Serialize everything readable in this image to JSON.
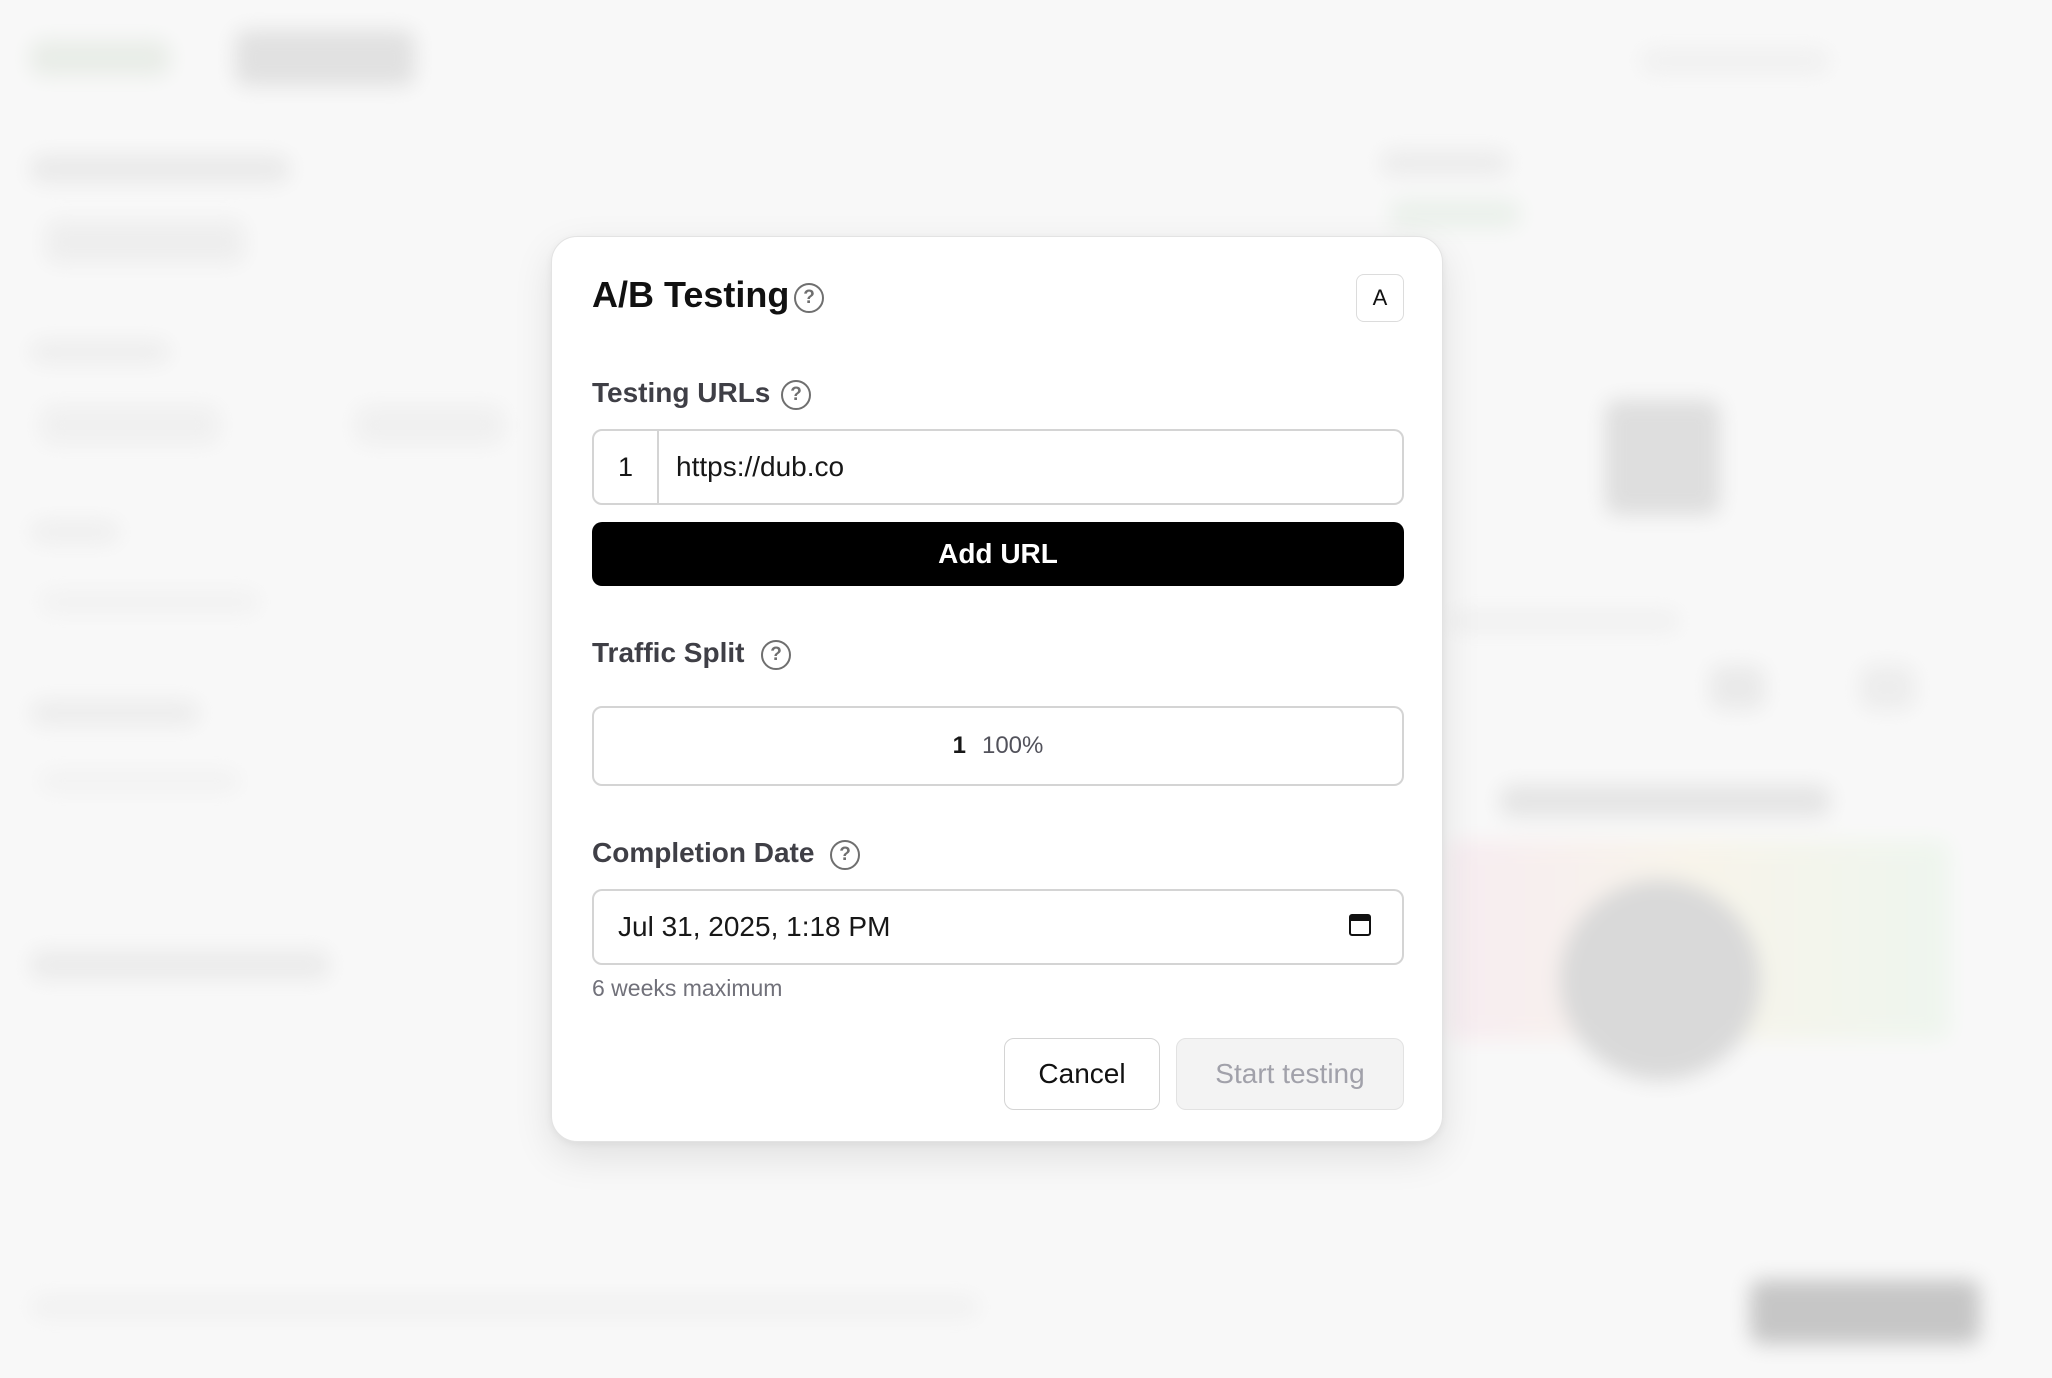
{
  "modal": {
    "title": "A/B Testing",
    "corner_badge": "A",
    "testing_urls": {
      "label": "Testing URLs",
      "rows": [
        {
          "index": "1",
          "url": "https://dub.co"
        }
      ],
      "add_button": "Add URL"
    },
    "traffic_split": {
      "label": "Traffic Split",
      "segments": [
        {
          "index": "1",
          "percent": "100%"
        }
      ]
    },
    "completion_date": {
      "label": "Completion Date",
      "value": "Jul 31, 2025, 1:18 PM",
      "hint": "6 weeks maximum"
    },
    "actions": {
      "cancel": "Cancel",
      "start": "Start testing"
    }
  },
  "colors": {
    "primary_button": "#000000",
    "disabled_button_bg": "#f3f3f3",
    "disabled_button_text": "#a1a1aa",
    "border": "#d4d4d4"
  }
}
